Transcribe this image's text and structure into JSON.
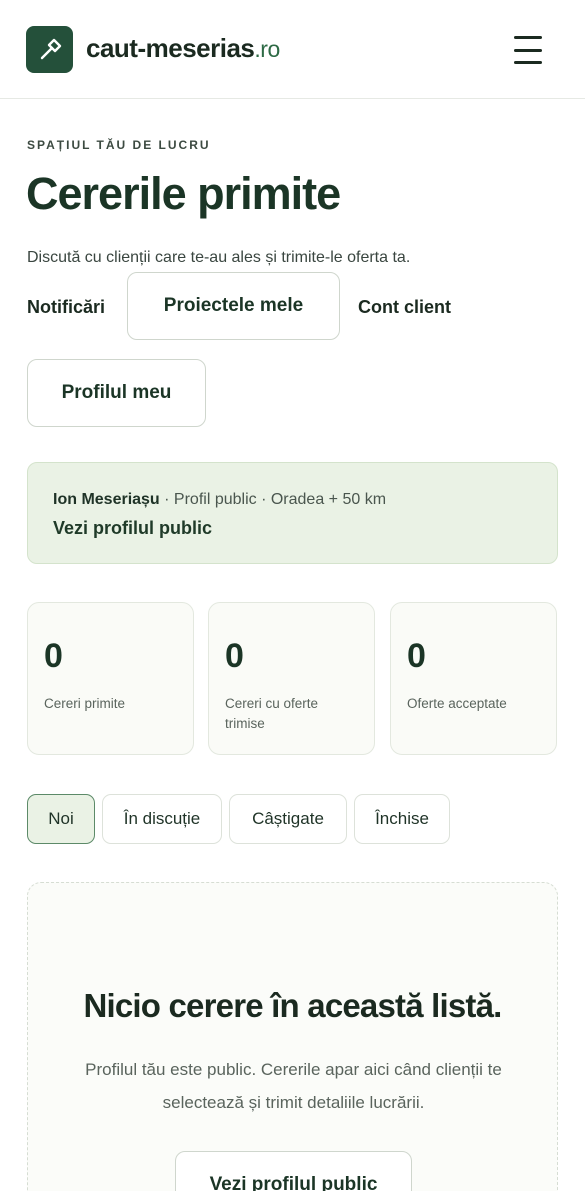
{
  "header": {
    "brand_name": "caut-meserias",
    "brand_tld": ".ro",
    "logo_icon": "hammer-icon",
    "menu_icon": "hamburger-menu-icon"
  },
  "page": {
    "eyebrow": "SPAȚIUL TĂU DE LUCRU",
    "title": "Cererile primite",
    "subtitle": "Discută cu clienții care te-au ales și trimite-le oferta ta."
  },
  "nav": {
    "notifications": "Notificări",
    "my_projects": "Proiectele mele",
    "client_account": "Cont client",
    "my_profile": "Profilul meu"
  },
  "profile": {
    "name": "Ion Meseriașu",
    "details": " · Profil public · Oradea + 50 km",
    "link": "Vezi profilul public"
  },
  "stats": [
    {
      "value": "0",
      "label": "Cereri primite"
    },
    {
      "value": "0",
      "label": "Cereri cu oferte trimise"
    },
    {
      "value": "0",
      "label": "Oferte acceptate"
    }
  ],
  "tabs": [
    {
      "label": "Noi",
      "active": true
    },
    {
      "label": "În discuție",
      "active": false
    },
    {
      "label": "Câștigate",
      "active": false
    },
    {
      "label": "Închise",
      "active": false
    }
  ],
  "empty_state": {
    "title": "Nicio cerere în această listă.",
    "text": "Profilul tău este public. Cererile apar aici când clienții te selectează și trimit detaliile lucrării.",
    "button": "Vezi profilul public"
  },
  "colors": {
    "brand_green": "#24503a",
    "accent_light": "#eaf2e5",
    "text_dark": "#1b3526"
  }
}
